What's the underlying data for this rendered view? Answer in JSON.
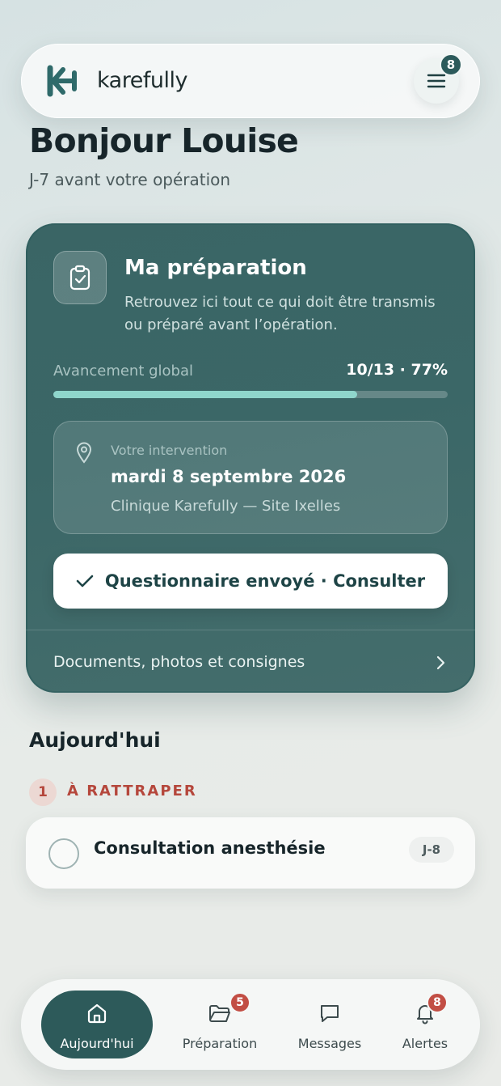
{
  "header": {
    "brand": "karefully",
    "menu_badge": "8"
  },
  "greeting": {
    "title": "Bonjour Louise",
    "subtitle": "J-7 avant votre opération"
  },
  "preparation_card": {
    "title": "Ma préparation",
    "description": "Retrouvez ici tout ce qui doit être transmis ou préparé avant l’opération.",
    "progress_label": "Avancement global",
    "progress_value": "10/13 · 77%",
    "progress_fraction": 0.77,
    "intervention": {
      "label": "Votre intervention",
      "date": "mardi 8 septembre 2026",
      "site": "Clinique Karefully — Site Ixelles"
    },
    "cta_label": "Questionnaire envoyé · Consulter",
    "docs_label": "Documents, photos et consignes"
  },
  "today": {
    "title": "Aujourd'hui",
    "late_count": "1",
    "late_label": "À RATTRAPER",
    "task": {
      "title": "Consultation anesthésie",
      "badge": "J-8"
    }
  },
  "bottom_nav": {
    "items": [
      {
        "label": "Aujourd'hui",
        "icon": "home-icon",
        "active": true
      },
      {
        "label": "Préparation",
        "icon": "folder-icon",
        "badge": "5"
      },
      {
        "label": "Messages",
        "icon": "message-icon"
      },
      {
        "label": "Alertes",
        "icon": "bell-icon",
        "badge": "8"
      }
    ]
  },
  "colors": {
    "primary": "#3a6565",
    "accent": "#8fd6cc",
    "alert": "#b5473c"
  }
}
